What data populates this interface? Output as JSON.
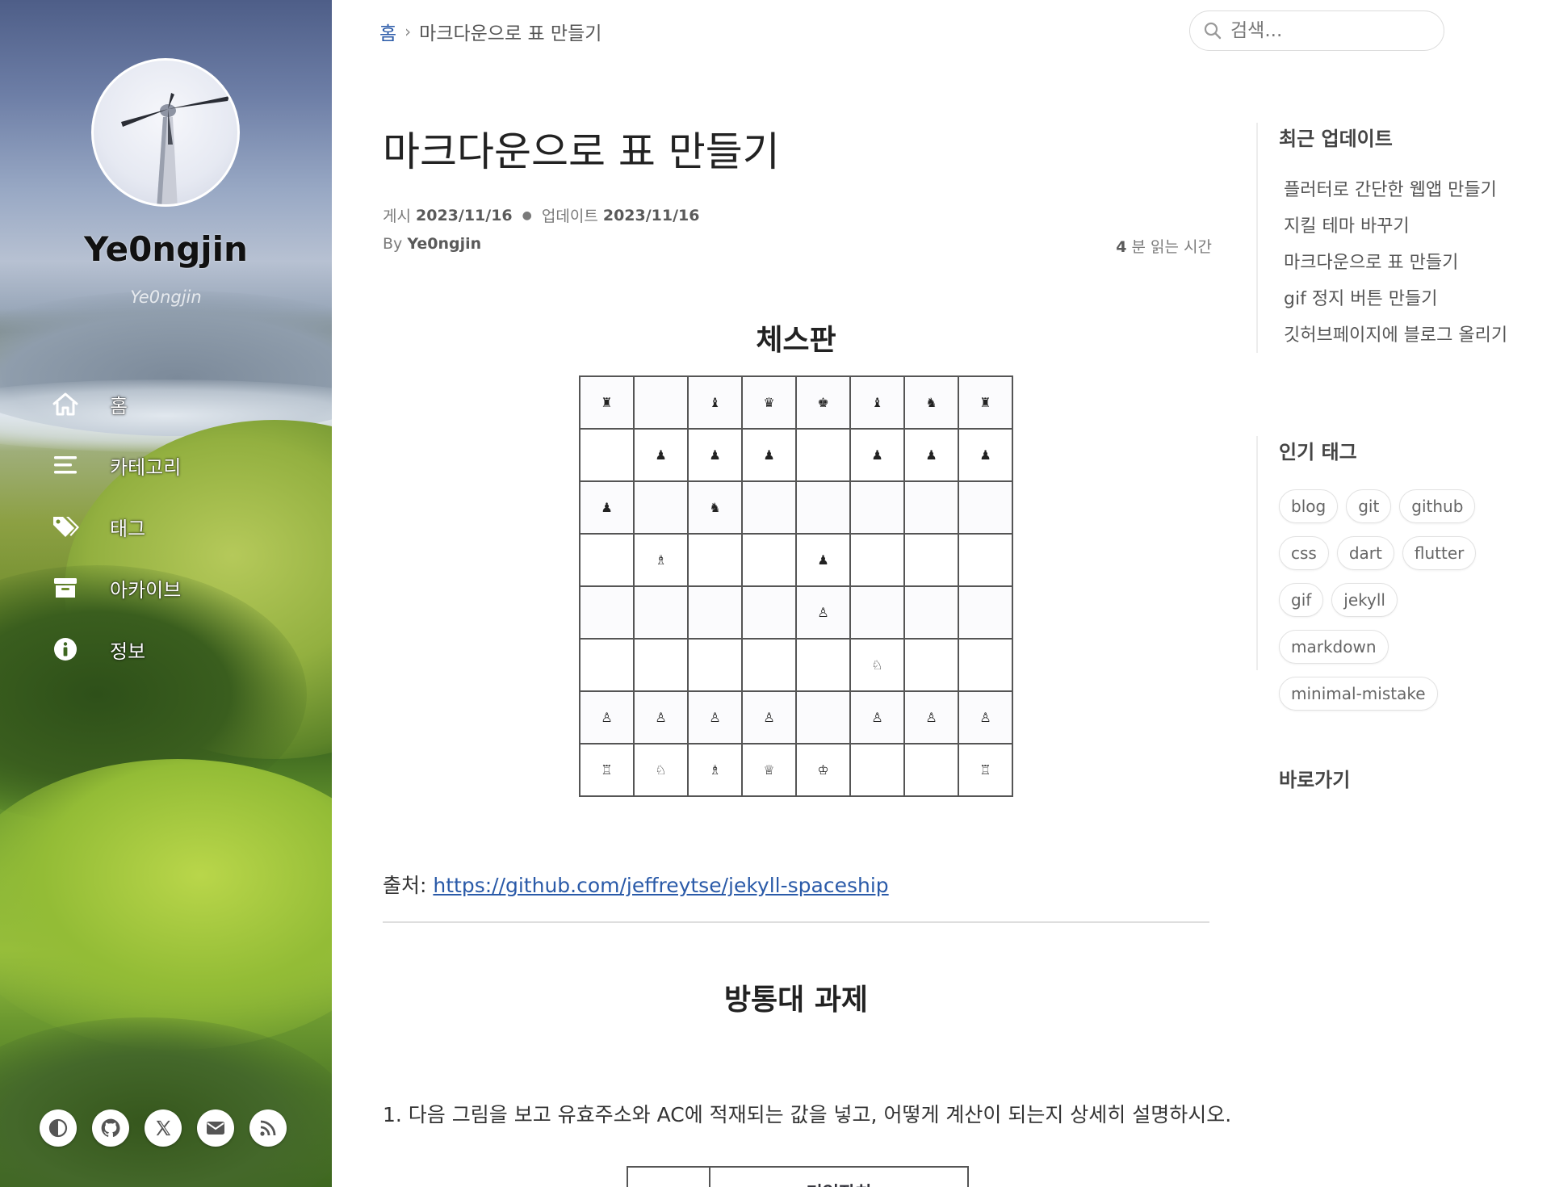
{
  "sidebar": {
    "site_title": "Ye0ngjin",
    "site_subtitle": "Ye0ngjin",
    "nav": [
      {
        "label": "홈",
        "icon": "home-icon"
      },
      {
        "label": "카테고리",
        "icon": "list-icon"
      },
      {
        "label": "태그",
        "icon": "tags-icon"
      },
      {
        "label": "아카이브",
        "icon": "archive-icon"
      },
      {
        "label": "정보",
        "icon": "info-icon"
      }
    ],
    "social_icons": [
      "theme-toggle-icon",
      "github-icon",
      "x-icon",
      "email-icon",
      "rss-icon"
    ]
  },
  "topbar": {
    "breadcrumb_home": "홈",
    "breadcrumb_sep": "›",
    "breadcrumb_current": "마크다운으로 표 만들기",
    "search_placeholder": "검색..."
  },
  "post": {
    "title": "마크다운으로 표 만들기",
    "posted_label": "게시",
    "posted_date": "2023/11/16",
    "updated_label": "업데이트",
    "updated_date": "2023/11/16",
    "by_label": "By",
    "author": "Ye0ngjin",
    "read_minutes": "4",
    "read_suffix": "분 읽는 시간",
    "chess_title": "체스판",
    "chessboard": [
      [
        "♜",
        "",
        "♝",
        "♛",
        "♚",
        "♝",
        "♞",
        "♜"
      ],
      [
        "",
        "♟",
        "♟",
        "♟",
        "",
        "♟",
        "♟",
        "♟"
      ],
      [
        "♟",
        "",
        "♞",
        "",
        "",
        "",
        "",
        ""
      ],
      [
        "",
        "♗",
        "",
        "",
        "♟",
        "",
        "",
        ""
      ],
      [
        "",
        "",
        "",
        "",
        "♙",
        "",
        "",
        ""
      ],
      [
        "",
        "",
        "",
        "",
        "",
        "♘",
        "",
        ""
      ],
      [
        "♙",
        "♙",
        "♙",
        "♙",
        "",
        "♙",
        "♙",
        "♙"
      ],
      [
        "♖",
        "♘",
        "♗",
        "♕",
        "♔",
        "",
        "",
        "♖"
      ]
    ],
    "source_label": "출처: ",
    "source_url": "https://github.com/jeffreytse/jekyll-spaceship",
    "section2_title": "방통대 과제",
    "question": "1. 다음 그림을 보고 유효주소와 AC에 적재되는 값을 넣고, 어떻게 계산이 되는지 상세히 설명하시오.",
    "table_header": "기억장치"
  },
  "right_sidebar": {
    "recent_title": "최근 업데이트",
    "recent_items": [
      "플러터로 간단한 웹앱 만들기",
      "지킬 테마 바꾸기",
      "마크다운으로 표 만들기",
      "gif 정지 버튼 만들기",
      "깃허브페이지에 블로그 올리기"
    ],
    "tags_title": "인기 태그",
    "tags": [
      "blog",
      "git",
      "github",
      "css",
      "dart",
      "flutter",
      "gif",
      "jekyll",
      "markdown",
      "minimal-mistake"
    ],
    "toc_title": "바로가기"
  },
  "colors": {
    "link": "#2a5aa8",
    "text": "#34343c",
    "sidebar_text": "#ffffff"
  }
}
